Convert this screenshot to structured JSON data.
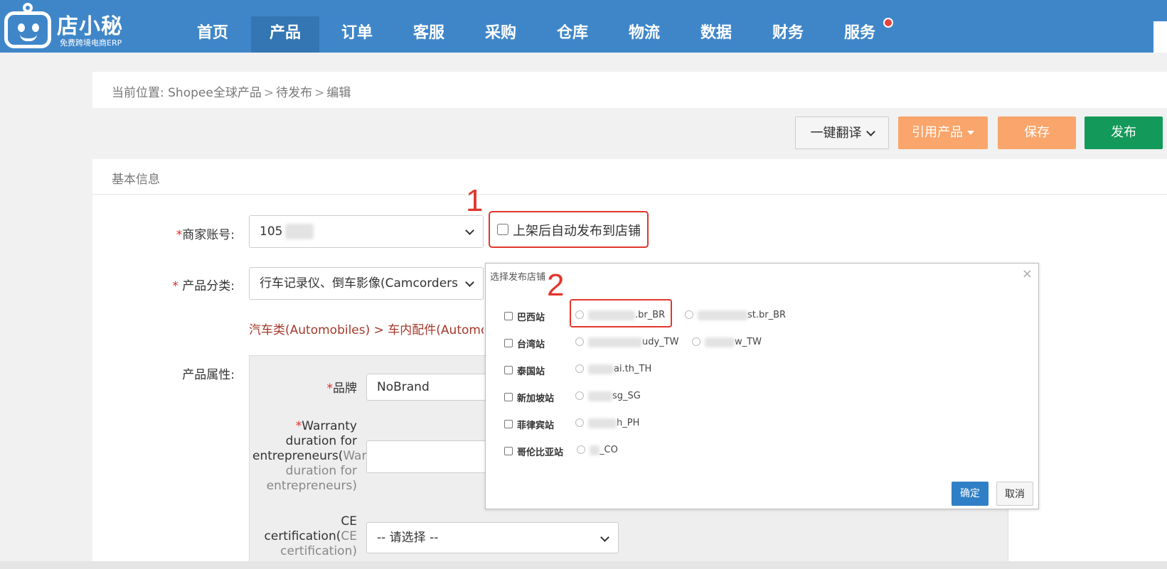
{
  "logo": {
    "title": "店小秘",
    "subtitle": "免费跨境电商ERP"
  },
  "nav": [
    {
      "label": "首页"
    },
    {
      "label": "产品"
    },
    {
      "label": "订单"
    },
    {
      "label": "客服"
    },
    {
      "label": "采购"
    },
    {
      "label": "仓库"
    },
    {
      "label": "物流"
    },
    {
      "label": "数据"
    },
    {
      "label": "财务"
    },
    {
      "label": "服务"
    }
  ],
  "breadcrumb": {
    "prefix": "当前位置:",
    "items": [
      "Shopee全球产品",
      "待发布",
      "编辑"
    ],
    "sep": ">"
  },
  "actions": {
    "translate": "一键翻译",
    "import": "引用产品",
    "save": "保存",
    "publish": "发布"
  },
  "section": {
    "title": "基本信息"
  },
  "form": {
    "account_label": "商家账号:",
    "account_value": "105",
    "category_label": "产品分类:",
    "category_value": "行车记录仪、倒车影像(Camcorders",
    "category_path": "汽车类(Automobiles) > 车内配件(Automobi",
    "attr_label": "产品属性:",
    "auto_publish_label": "上架后自动发布到店铺",
    "brand_label": "品牌",
    "brand_value": "NoBrand",
    "warranty_label_1": "Warranty",
    "warranty_label_2": "duration for",
    "warranty_label_3": "entrepreneurs(",
    "warranty_label_3b": "War",
    "warranty_label_4": "duration for",
    "warranty_label_5": "entrepreneurs)",
    "ce_label_1": "CE",
    "ce_label_2": "certification(",
    "ce_label_2b": "CE",
    "ce_label_3": "certification)",
    "ce_value": "-- 请选择 --"
  },
  "annotations": {
    "one": "1",
    "two": "2"
  },
  "modal": {
    "title": "选择发布店铺",
    "close": "×",
    "sites": [
      {
        "name": "巴西站",
        "shops": [
          ".br_BR",
          "st.br_BR"
        ]
      },
      {
        "name": "台湾站",
        "shops": [
          "udy_TW",
          "w_TW"
        ]
      },
      {
        "name": "泰国站",
        "shops": [
          "ai.th_TH"
        ]
      },
      {
        "name": "新加坡站",
        "shops": [
          "sg_SG"
        ]
      },
      {
        "name": "菲律宾站",
        "shops": [
          "h_PH"
        ]
      },
      {
        "name": "哥伦比亚站",
        "shops": [
          "_CO"
        ]
      }
    ],
    "ok": "确定",
    "cancel": "取消"
  }
}
